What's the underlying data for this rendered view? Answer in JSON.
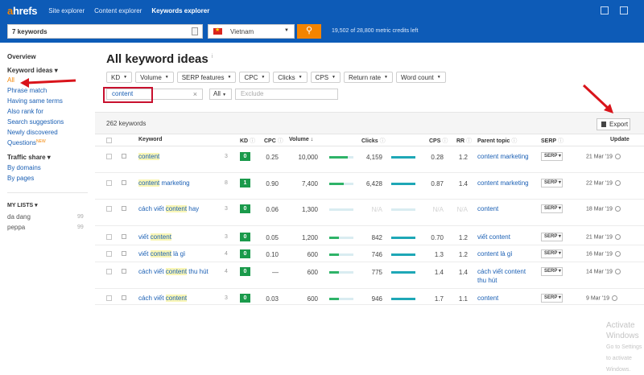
{
  "logo": {
    "a": "a",
    "rest": "hrefs"
  },
  "nav": {
    "site_explorer": "Site explorer",
    "content_explorer": "Content explorer",
    "keywords_explorer": "Keywords explorer"
  },
  "search": {
    "value": "7 keywords",
    "country": "Vietnam",
    "credits": "19,502 of 28,800 metric credits left"
  },
  "sidebar": {
    "overview": "Overview",
    "keyword_ideas": "Keyword ideas ▾",
    "items": [
      "All",
      "Phrase match",
      "Having same terms",
      "Also rank for",
      "Search suggestions",
      "Newly discovered",
      "Questions"
    ],
    "new_badge": "NEW",
    "traffic_share": "Traffic share ▾",
    "traffic_items": [
      "By domains",
      "By pages"
    ],
    "my_lists": "MY LISTS ▾",
    "lists": [
      {
        "name": "da dang",
        "count": "99"
      },
      {
        "name": "peppa",
        "count": "99"
      }
    ]
  },
  "main": {
    "title": "All keyword ideas",
    "filters": [
      "KD",
      "Volume",
      "SERP features",
      "CPC",
      "Clicks",
      "CPS",
      "Return rate",
      "Word count"
    ],
    "include_value": "content",
    "all_select": "All",
    "exclude_placeholder": "Exclude",
    "count": "262 keywords",
    "export": "Export"
  },
  "columns": {
    "keyword": "Keyword",
    "kd": "KD",
    "cpc": "CPC",
    "volume": "Volume",
    "clicks": "Clicks",
    "cps": "CPS",
    "rr": "RR",
    "parent": "Parent topic",
    "serp": "SERP",
    "update": "Update"
  },
  "rows": [
    {
      "pre": "",
      "hl": "content",
      "post": "",
      "pos": "3",
      "kd": "0",
      "cpc": "0.25",
      "volume": "10,000",
      "vol_fill": 0.75,
      "clicks": "4,159",
      "clk_fill": 0.45,
      "clk_bar": 1.0,
      "cps": "0.28",
      "rr": "1.2",
      "parent": "content marketing",
      "serp": "SERP",
      "update": "21 Mar '19"
    },
    {
      "pre": "",
      "hl": "content",
      "post": " marketing",
      "pos": "8",
      "kd": "1",
      "cpc": "0.90",
      "volume": "7,400",
      "vol_fill": 0.6,
      "clicks": "6,428",
      "clk_fill": 0.7,
      "clk_bar": 1.0,
      "cps": "0.87",
      "rr": "1.4",
      "parent": "content marketing",
      "serp": "SERP",
      "update": "22 Mar '19"
    },
    {
      "pre": "cách viết ",
      "hl": "content",
      "post": " hay",
      "pos": "3",
      "kd": "0",
      "cpc": "0.06",
      "volume": "1,300",
      "vol_fill": 0.0,
      "clicks": "N/A",
      "clk_fill": 0,
      "clk_bar": 0,
      "cps": "N/A",
      "rr": "N/A",
      "parent": "content",
      "serp": "SERP",
      "update": "18 Mar '19"
    },
    {
      "pre": "viết ",
      "hl": "content",
      "post": "",
      "pos": "3",
      "kd": "0",
      "cpc": "0.05",
      "volume": "1,200",
      "vol_fill": 0.4,
      "clicks": "842",
      "clk_fill": 0.6,
      "clk_bar": 1.0,
      "cps": "0.70",
      "rr": "1.2",
      "parent": "viết content",
      "serp": "SERP",
      "update": "21 Mar '19"
    },
    {
      "pre": "viết ",
      "hl": "content",
      "post": " là gì",
      "pos": "4",
      "kd": "0",
      "cpc": "0.10",
      "volume": "600",
      "vol_fill": 0.4,
      "clicks": "746",
      "clk_fill": 0.75,
      "clk_bar": 1.0,
      "cps": "1.3",
      "rr": "1.2",
      "parent": "content là gì",
      "serp": "SERP",
      "update": "16 Mar '19"
    },
    {
      "pre": "cách viết ",
      "hl": "content",
      "post": " thu hút",
      "pos": "4",
      "kd": "0",
      "cpc": "—",
      "volume": "600",
      "vol_fill": 0.4,
      "clicks": "775",
      "clk_fill": 0.75,
      "clk_bar": 1.0,
      "cps": "1.4",
      "rr": "1.4",
      "parent": "cách viết content thu hút",
      "serp": "SERP",
      "update": "14 Mar '19"
    },
    {
      "pre": "cách viết ",
      "hl": "content",
      "post": "",
      "pos": "3",
      "kd": "0",
      "cpc": "0.03",
      "volume": "600",
      "vol_fill": 0.4,
      "clicks": "946",
      "clk_fill": 0.8,
      "clk_bar": 1.0,
      "cps": "1.7",
      "rr": "1.1",
      "parent": "content",
      "serp": "SERP",
      "update": "9 Mar '19"
    }
  ],
  "watermark": {
    "line1": "Activate Windows",
    "line2": "Go to Settings to activate Windows."
  },
  "colors": {
    "brand_blue": "#0d5bb7",
    "accent_orange": "#f48400",
    "kd_green": "#1a9a4b",
    "annotation_red": "#c8102e"
  }
}
